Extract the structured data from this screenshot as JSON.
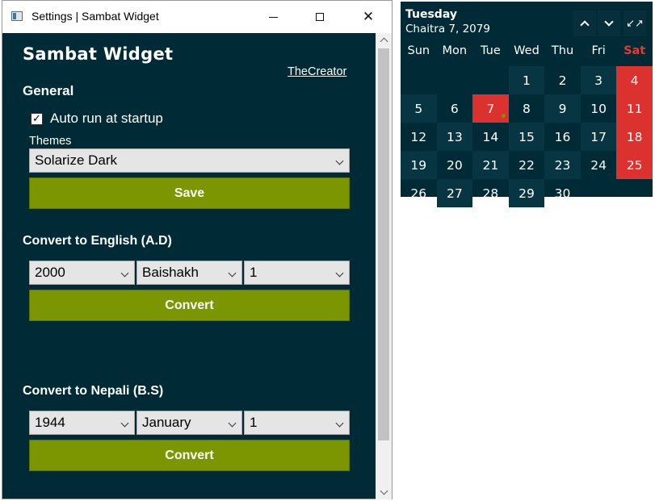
{
  "window": {
    "title": "Settings | Sambat Widget",
    "controls": {
      "minimize": "minimize",
      "maximize": "maximize",
      "close": "✕"
    }
  },
  "app": {
    "title": "Sambat Widget",
    "creator_link": "TheCreator"
  },
  "general": {
    "title": "General",
    "autorun_label": "Auto run at startup",
    "autorun_checked": true,
    "autorun_check_glyph": "✓",
    "themes_label": "Themes",
    "theme_value": "Solarize Dark",
    "save_label": "Save"
  },
  "convert_english": {
    "title": "Convert to English (A.D)",
    "year": "2000",
    "month": "Baishakh",
    "day": "1",
    "button_label": "Convert"
  },
  "convert_nepali": {
    "title": "Convert to Nepali (B.S)",
    "year": "1944",
    "month": "January",
    "day": "1",
    "button_label": "Convert"
  },
  "calendar": {
    "day_name": "Tuesday",
    "date_text": "Chaitra 7, 2079",
    "nav": {
      "up_icon": "chevron-up-icon",
      "down_icon": "chevron-down-icon",
      "collapse_icon": "collapse-icon",
      "collapse_glyph": "↙↗"
    },
    "weekdays": [
      "Sun",
      "Mon",
      "Tue",
      "Wed",
      "Thu",
      "Fri",
      "Sat"
    ],
    "weeks": [
      [
        "",
        "",
        "",
        "1",
        "2",
        "3",
        "4"
      ],
      [
        "5",
        "6",
        "7",
        "8",
        "9",
        "10",
        "11"
      ],
      [
        "12",
        "13",
        "14",
        "15",
        "16",
        "17",
        "18"
      ],
      [
        "19",
        "20",
        "21",
        "22",
        "23",
        "24",
        "25"
      ],
      [
        "26",
        "27",
        "28",
        "29",
        "30",
        "",
        ""
      ]
    ],
    "today": "7",
    "colors": {
      "background": "#002b36",
      "cell_shade": "#073642",
      "holiday_red": "#dc322f",
      "today_dot": "#7b9600",
      "accent_green": "#7b9600"
    }
  }
}
